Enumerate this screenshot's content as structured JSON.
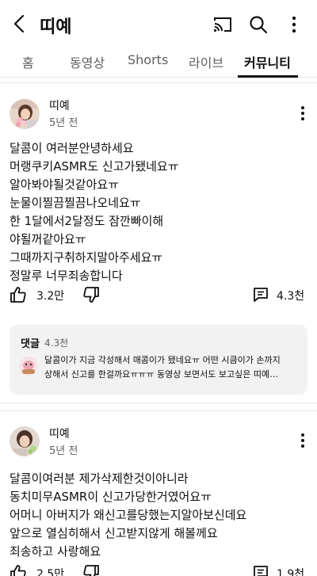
{
  "header": {
    "title": "띠예",
    "back_icon": "back-arrow-icon",
    "cast_icon": "cast-icon",
    "search_icon": "search-icon",
    "more_icon": "more-vertical-icon"
  },
  "tabs": [
    {
      "label": "홈",
      "active": false
    },
    {
      "label": "동영상",
      "active": false
    },
    {
      "label": "Shorts",
      "active": false
    },
    {
      "label": "라이브",
      "active": false
    },
    {
      "label": "커뮤니티",
      "active": true
    }
  ],
  "posts": [
    {
      "author": "띠예",
      "time": "5년 전",
      "lines": [
        "달콤이 여러분안녕하세요",
        "머랭쿠키ASMR도 신고가됐네요ㅠ",
        "알아봐야될것같아요ㅠ",
        "눈물이찔끔찔끔나오네요ㅠ",
        "한  1달에서2달정도 잠깐빠이해",
        "야될꺼같아요ㅠ",
        "그때까지구취하지말아주세요ㅠ",
        "정말루 너무죄송합니다"
      ],
      "likes": "3.2만",
      "comments": "4.3천",
      "comments_box": {
        "label": "댓글",
        "count": "4.3천",
        "preview_lines": [
          "달콤이가 지금 각성해서 매콤이가 됐네요ㅠ 어떤 시큼이가 손까지",
          "상해서 신고를 한걸까요ㅠㅠㅠ 동영상 보면서도 보고싶은 띠예…"
        ]
      }
    },
    {
      "author": "띠예",
      "time": "5년 전",
      "lines": [
        "달콤이여러분 제가삭제한것이아니라",
        "동치미무ASMR이 신고가당한거였어요ㅠ",
        "어머니 아버지가 왜신고를당했는지알아보신데요",
        "앞으로 열심히해서 신고받지않게 해볼께요",
        "죄송하고 사랑해요"
      ],
      "likes": "2.5만",
      "comments": "1.9천"
    }
  ],
  "colors": {
    "text": "#0f0f0f",
    "secondary": "#606060",
    "divider": "#e5e5e5",
    "comment_bg": "#f2f2f2"
  }
}
